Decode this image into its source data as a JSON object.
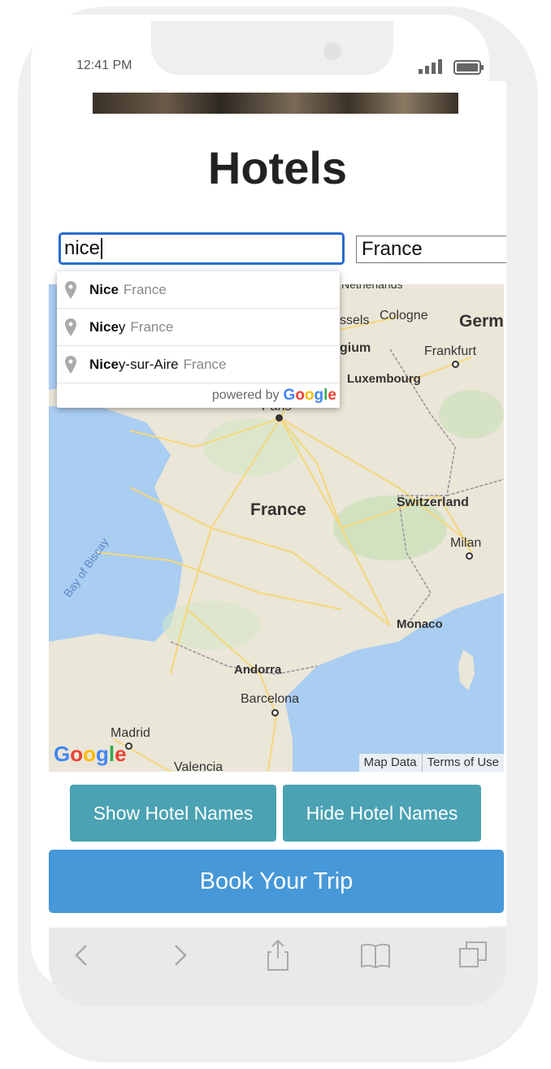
{
  "status_bar": {
    "time": "12:41 PM"
  },
  "page": {
    "title": "Hotels"
  },
  "search": {
    "city_value": "nice",
    "country_value": "France"
  },
  "autocomplete": {
    "items": [
      {
        "match": "Nice",
        "rest": "",
        "secondary": "France"
      },
      {
        "match": "Nice",
        "rest": "y",
        "secondary": "France"
      },
      {
        "match": "Nice",
        "rest": "y-sur-Aire",
        "secondary": "France"
      }
    ],
    "powered_by": "powered by",
    "provider": "Google"
  },
  "map": {
    "labels": {
      "netherlands": "Netherlands",
      "cologne": "Cologne",
      "germany": "Germ",
      "brussels": "ssels",
      "belgium": "gium",
      "frankfurt": "Frankfurt",
      "luxembourg": "Luxembourg",
      "paris": "Paris",
      "france": "France",
      "switzerland": "Switzerland",
      "milan": "Milan",
      "bay_of_biscay": "Bay of Biscay",
      "monaco": "Monaco",
      "andorra": "Andorra",
      "barcelona": "Barcelona",
      "madrid": "Madrid",
      "valencia": "Valencia"
    },
    "logo": "Google",
    "map_data": "Map Data",
    "terms": "Terms of Use",
    "colors": {
      "land": "#eae6d8",
      "water": "#aacdf2",
      "roads": "#f5d77a",
      "forest": "#c8dfb8"
    }
  },
  "buttons": {
    "show_hotel_names": "Show Hotel Names",
    "hide_hotel_names": "Hide Hotel Names",
    "book_trip": "Book Your Trip"
  },
  "toolbar": {
    "icons": [
      "back-icon",
      "forward-icon",
      "share-icon",
      "bookmarks-icon",
      "tabs-icon"
    ]
  },
  "colors": {
    "accent_teal": "#4aa2b3",
    "accent_blue": "#4698d8",
    "input_focus": "#2a6bd0"
  }
}
